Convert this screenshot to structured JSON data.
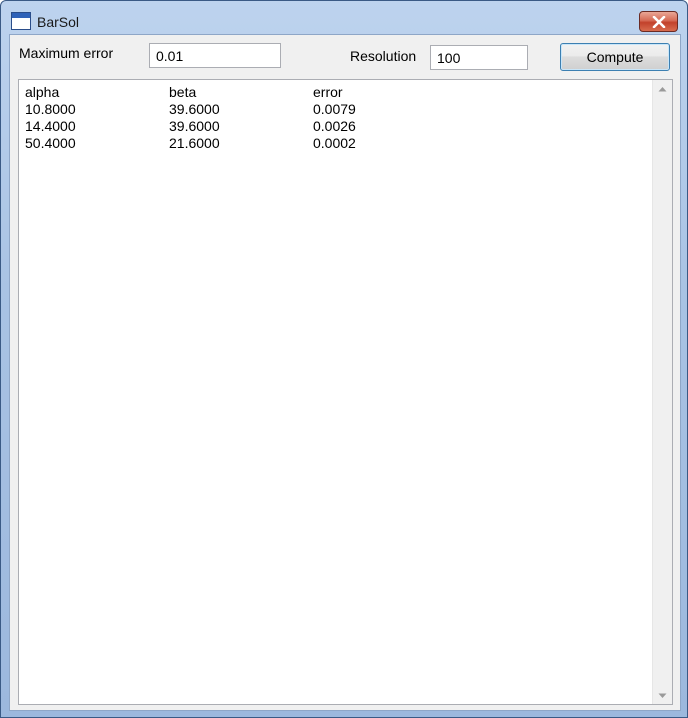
{
  "window": {
    "title": "BarSol",
    "close_label": "×"
  },
  "form": {
    "max_error_label": "Maximum error",
    "max_error_value": "0.01",
    "resolution_label": "Resolution",
    "resolution_value": "100",
    "compute_label": "Compute"
  },
  "results": {
    "headers": [
      "alpha",
      "beta",
      "error"
    ],
    "rows": [
      [
        "10.8000",
        "39.6000",
        "0.0079"
      ],
      [
        "14.4000",
        "39.6000",
        "0.0026"
      ],
      [
        "50.4000",
        "21.6000",
        "0.0002"
      ]
    ]
  }
}
